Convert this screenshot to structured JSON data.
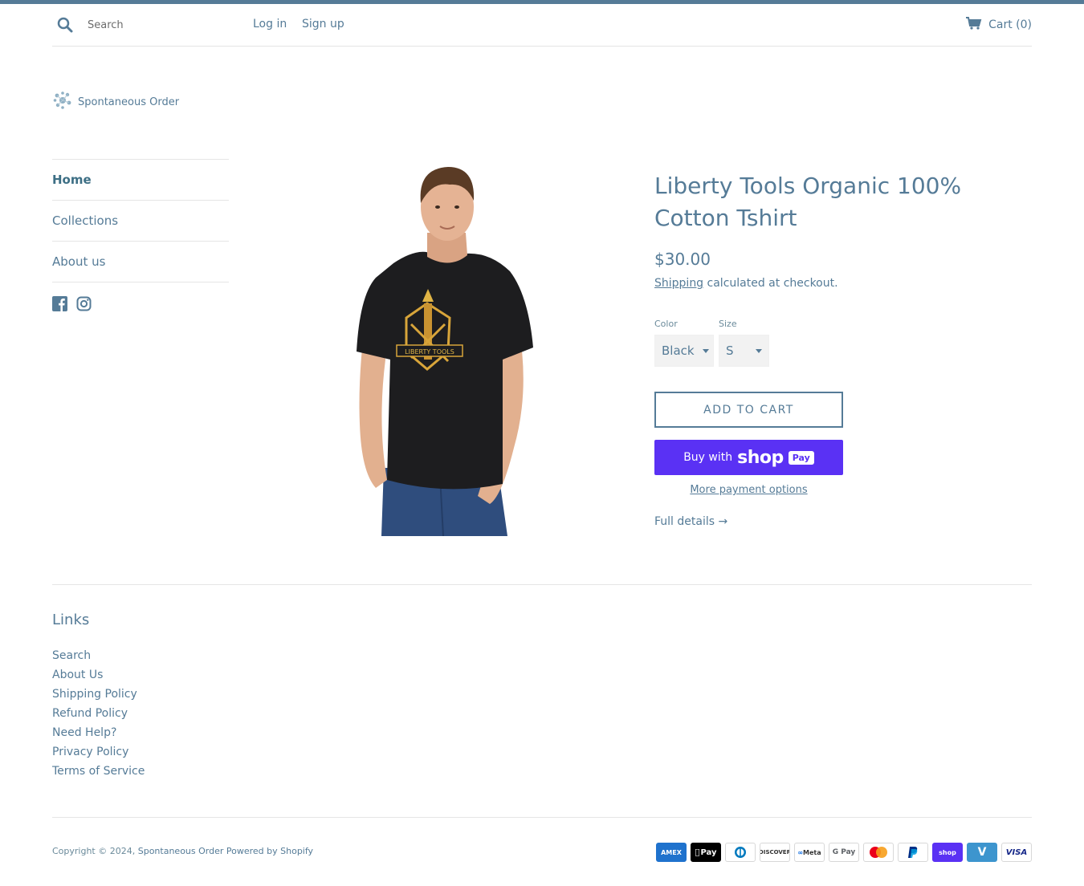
{
  "header": {
    "search_placeholder": "Search",
    "login_label": "Log in",
    "signup_label": "Sign up",
    "cart_label": "Cart (0)"
  },
  "logo": {
    "text": "Spontaneous Order"
  },
  "sidenav": {
    "items": [
      {
        "label": "Home"
      },
      {
        "label": "Collections"
      },
      {
        "label": "About us"
      }
    ],
    "social": [
      "facebook-icon",
      "instagram-icon"
    ]
  },
  "product": {
    "title": "Liberty Tools Organic 100% Cotton Tshirt",
    "price": "$30.00",
    "shipping_link": "Shipping",
    "shipping_text": " calculated at checkout.",
    "color_label": "Color",
    "color_value": "Black",
    "size_label": "Size",
    "size_value": "S",
    "add_to_cart": "ADD TO CART",
    "buy_with": "Buy with",
    "shop_word": "shop",
    "pay_badge": "Pay",
    "more_payment": "More payment options",
    "full_details": "Full details →",
    "image_logo_text": "LIBERTY TOOLS"
  },
  "footer": {
    "heading": "Links",
    "links": [
      "Search",
      "About Us",
      "Shipping Policy",
      "Refund Policy",
      "Need Help?",
      "Privacy Policy",
      "Terms of Service"
    ],
    "copyright_prefix": "Copyright © 2024, ",
    "store_name": "Spontaneous Order",
    "powered_by": "Powered by Shopify",
    "payment_methods": [
      "AMEX",
      "Pay",
      "Diners",
      "DISCOVER",
      "Meta",
      "G Pay",
      "Mastercard",
      "PayPal",
      "shop",
      "V",
      "VISA"
    ]
  },
  "colors": {
    "accent": "#557b97",
    "shoppay": "#5a31f4"
  }
}
